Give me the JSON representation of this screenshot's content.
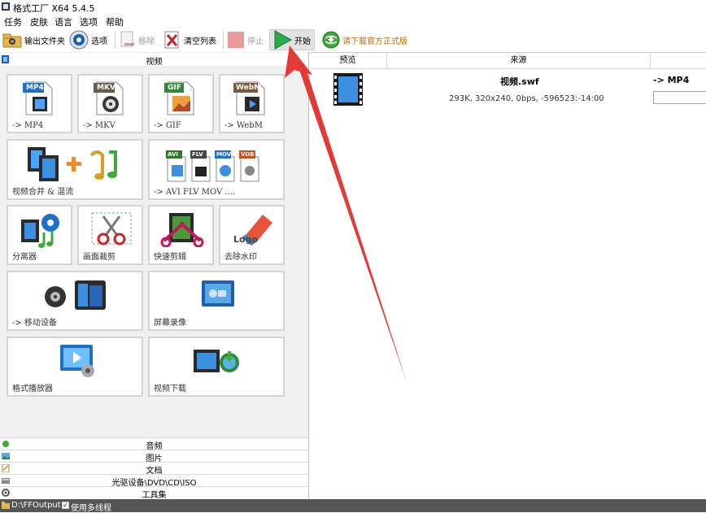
{
  "window": {
    "title": "格式工厂 X64 5.4.5"
  },
  "menu": [
    "任务",
    "皮肤",
    "语言",
    "选项",
    "帮助"
  ],
  "toolbar": {
    "output_folder": "输出文件夹",
    "options": "选项",
    "remove": "移除",
    "clear_list": "清空列表",
    "stop": "停止",
    "start": "开始",
    "download": "请下载官方正式版"
  },
  "left": {
    "video_category": "视频",
    "tiles": [
      {
        "label": "-> MP4",
        "badge": "MP4",
        "badge_color": "#1e6fc8",
        "icon": "mp4-icon"
      },
      {
        "label": "-> MKV",
        "badge": "MKV",
        "badge_color": "#6b5a4a",
        "icon": "mkv-icon"
      },
      {
        "label": "-> GIF",
        "badge": "GIF",
        "badge_color": "#2f8a3a",
        "icon": "gif-icon"
      },
      {
        "label": "-> WebM",
        "badge": "WebM",
        "badge_color": "#7a5a3a",
        "icon": "webm-icon"
      },
      {
        "label": "视频合并 & 混流",
        "icon": "video-merge-icon"
      },
      {
        "label": "-> AVI FLV MOV ....",
        "badges": [
          "AVI",
          "FLV",
          "MOV",
          "VOB"
        ],
        "icon": "multi-format-icon"
      },
      {
        "label": "分离器",
        "icon": "splitter-icon"
      },
      {
        "label": "画面裁剪",
        "icon": "crop-icon"
      },
      {
        "label": "快速剪辑",
        "icon": "quick-clip-icon"
      },
      {
        "label": "去除水印",
        "logo_text": "Logo",
        "icon": "remove-watermark-icon"
      },
      {
        "label": "-> 移动设备",
        "icon": "mobile-device-icon"
      },
      {
        "label": "屏幕录像",
        "icon": "screen-record-icon"
      },
      {
        "label": "格式播放器",
        "icon": "player-icon"
      },
      {
        "label": "视频下载",
        "icon": "video-download-icon"
      }
    ],
    "categories": [
      "音频",
      "图片",
      "文档",
      "光驱设备\\DVD\\CD\\ISO",
      "工具集"
    ]
  },
  "list": {
    "columns": [
      "预览",
      "来源"
    ],
    "rows": [
      {
        "name": "视频.swf",
        "info": "293K, 320x240, 0bps, -596523:-14:00",
        "target": "-> MP4"
      }
    ]
  },
  "status": {
    "output_path": "D:\\FFOutput",
    "multithread_label": "使用多线程",
    "multithread_checked": true
  },
  "colors": {
    "accent_arrow": "#e53935",
    "start_green": "#2aa84a"
  }
}
